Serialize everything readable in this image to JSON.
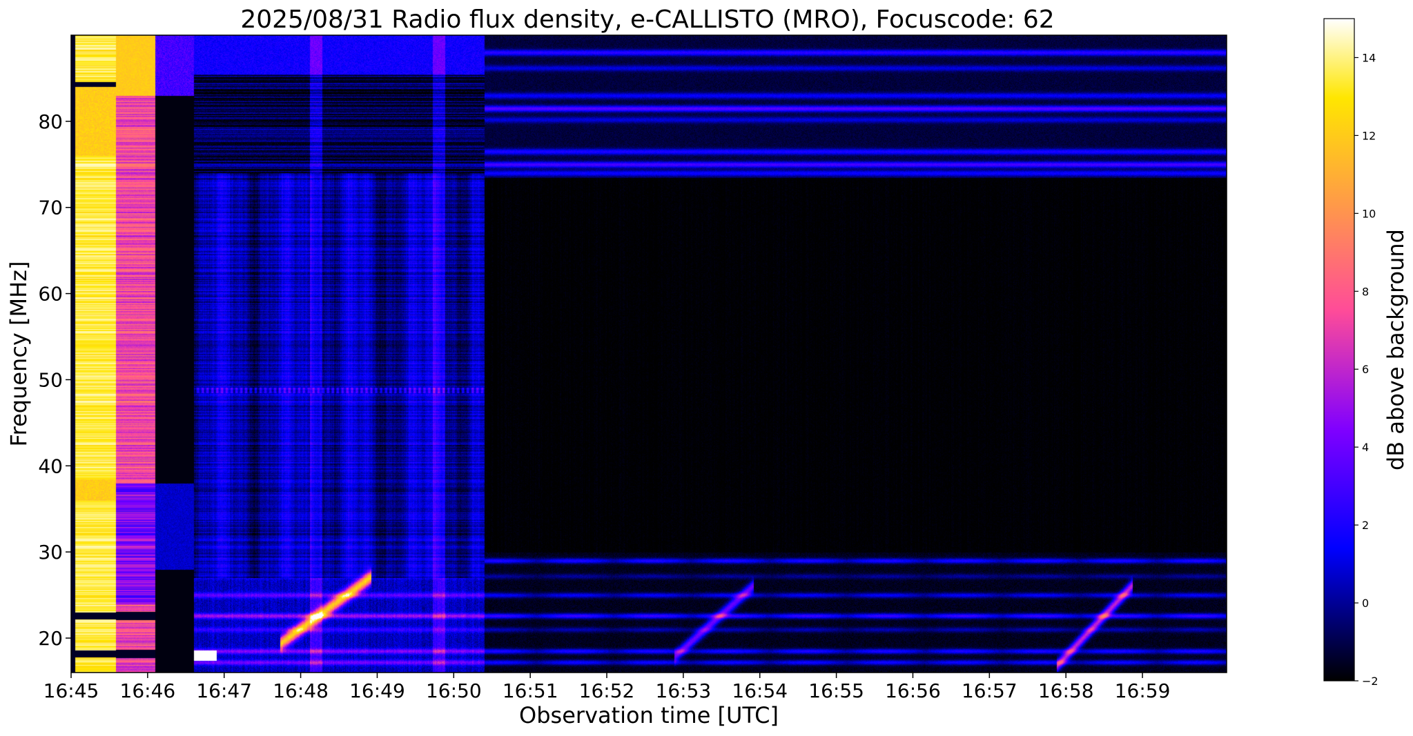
{
  "chart_data": {
    "type": "heatmap",
    "title": "2025/08/31  Radio flux density, e-CALLISTO (MRO), Focuscode: 62",
    "xlabel": "Observation time [UTC]",
    "ylabel": "Frequency [MHz]",
    "colorbar_label": "dB above background",
    "colormap": "gnuplot2",
    "x_ticks": [
      "16:45",
      "16:46",
      "16:47",
      "16:48",
      "16:49",
      "16:50",
      "16:51",
      "16:52",
      "16:53",
      "16:54",
      "16:55",
      "16:56",
      "16:57",
      "16:58",
      "16:59"
    ],
    "xlim_minutes": [
      0,
      15.1
    ],
    "y_ticks": [
      20,
      30,
      40,
      50,
      60,
      70,
      80
    ],
    "ylim": [
      16,
      90
    ],
    "colorbar_ticks": [
      -2,
      0,
      2,
      4,
      6,
      8,
      10,
      12,
      14
    ],
    "clim": [
      -2,
      15
    ],
    "colors": {
      "gnuplot2_stops": [
        "#000000",
        "#0000ff",
        "#8000ff",
        "#ff4c98",
        "#ff9a48",
        "#ffe600",
        "#ffffff"
      ],
      "grid": "none"
    },
    "features": [
      {
        "name": "saturated interference",
        "t_start_min": 0.05,
        "t_end_min": 0.6,
        "f_range": [
          16,
          90
        ],
        "db": 15
      },
      {
        "name": "strong interference",
        "t_start_min": 0.6,
        "t_end_min": 1.1,
        "f_range": [
          16,
          90
        ],
        "db": 10
      },
      {
        "name": "broadband elevated background",
        "t_start_min": 1.6,
        "t_end_min": 5.4,
        "f_range": [
          16,
          74
        ],
        "db": 3
      },
      {
        "name": "type III-like drift",
        "t_start_min": 2.7,
        "t_end_min": 3.9,
        "f_range": [
          20,
          27
        ],
        "db": 11
      },
      {
        "name": "drifting burst",
        "t_start_min": 7.9,
        "t_end_min": 8.9,
        "f_range": [
          18,
          26
        ],
        "db": 5
      },
      {
        "name": "drifting burst",
        "t_start_min": 12.9,
        "t_end_min": 13.8,
        "f_range": [
          17,
          26
        ],
        "db": 7
      },
      {
        "name": "narrowband interference lines",
        "t_start_min": 5.4,
        "t_end_min": 15.1,
        "f_range": [
          74,
          89
        ],
        "db": 2
      }
    ]
  }
}
